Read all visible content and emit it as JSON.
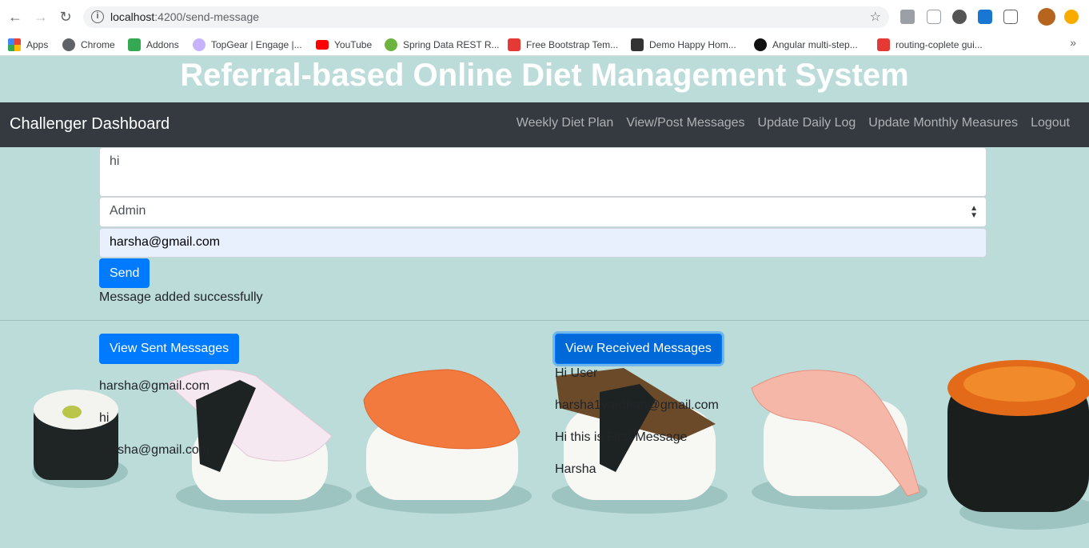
{
  "browser": {
    "url_host": "localhost",
    "url_path": ":4200/send-message",
    "bookmarks": [
      {
        "label": "Apps",
        "color": "#ea4335"
      },
      {
        "label": "Chrome",
        "color": "#5f6368"
      },
      {
        "label": "Addons",
        "color": "#34a853"
      },
      {
        "label": "TopGear | Engage |...",
        "color": "#7c4dff"
      },
      {
        "label": "YouTube",
        "color": "#ff0000"
      },
      {
        "label": "Spring Data REST R...",
        "color": "#6db33f"
      },
      {
        "label": "Free Bootstrap Tem...",
        "color": "#e53935"
      },
      {
        "label": "Demo Happy Hom...",
        "color": "#333333"
      },
      {
        "label": "Angular multi-step...",
        "color": "#111111"
      },
      {
        "label": "routing-coplete gui...",
        "color": "#e53935"
      }
    ],
    "more": "»"
  },
  "app": {
    "title": "Referral-based Online Diet Management System",
    "brand": "Challenger Dashboard",
    "nav": [
      "Weekly Diet Plan",
      "View/Post Messages",
      "Update Daily Log",
      "Update Monthly Measures",
      "Logout"
    ]
  },
  "form": {
    "message": "hi",
    "recipient_type": "Admin",
    "email": "harsha@gmail.com",
    "send_label": "Send",
    "status": "Message added successfully"
  },
  "sent": {
    "button": "View Sent Messages",
    "lines": [
      "harsha@gmail.com",
      "hi",
      "harsha@gmail.com"
    ]
  },
  "received": {
    "button": "View Received Messages",
    "lines": [
      "Hi User",
      "harsha1vardhan@gmail.com",
      "Hi this is First Message",
      "Harsha"
    ]
  }
}
